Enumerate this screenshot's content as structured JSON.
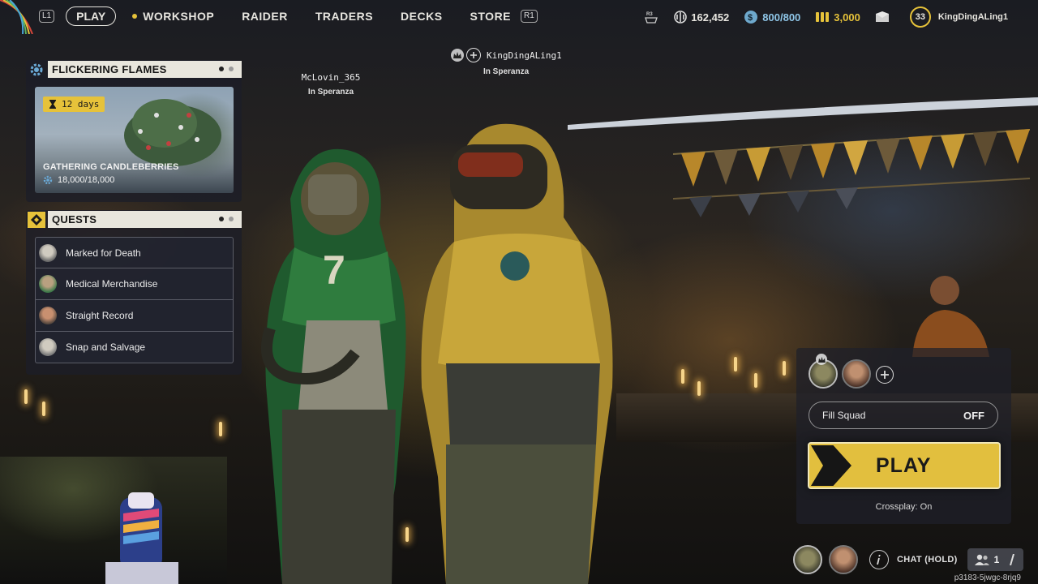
{
  "nav": {
    "l1_hint": "L1",
    "play": "PLAY",
    "workshop": "WORKSHOP",
    "raider": "RAIDER",
    "traders": "TRADERS",
    "decks": "DECKS",
    "store": "STORE",
    "r1_hint": "R1"
  },
  "status": {
    "r3_hint": "R3",
    "raider_tokens": "162,452",
    "credits": "800/800",
    "coins": "3,000",
    "level": "33",
    "username": "KingDingALing1"
  },
  "event": {
    "title": "FLICKERING FLAMES",
    "time_left": "12 days",
    "name": "GATHERING CANDLEBERRIES",
    "progress": "18,000/18,000",
    "progress_fraction": 1.0
  },
  "quests": {
    "title": "QUESTS",
    "items": [
      {
        "label": "Marked for Death"
      },
      {
        "label": "Medical Merchandise"
      },
      {
        "label": "Straight Record"
      },
      {
        "label": "Snap and Salvage"
      }
    ]
  },
  "players": {
    "left": {
      "name": "McLovin_365",
      "location": "In Speranza"
    },
    "right": {
      "name": "KingDingALing1",
      "location": "In Speranza"
    }
  },
  "lobby": {
    "fill_squad_label": "Fill Squad",
    "fill_squad_value": "OFF",
    "play_label": "PLAY",
    "crossplay": "Crossplay: On"
  },
  "footer": {
    "chat_label": "CHAT (HOLD)",
    "friends_count": "1",
    "session_code": "p3183-5jwgc-8rjq9"
  },
  "colors": {
    "accent": "#e2bf3e",
    "panel_header": "#e8e6dd"
  }
}
